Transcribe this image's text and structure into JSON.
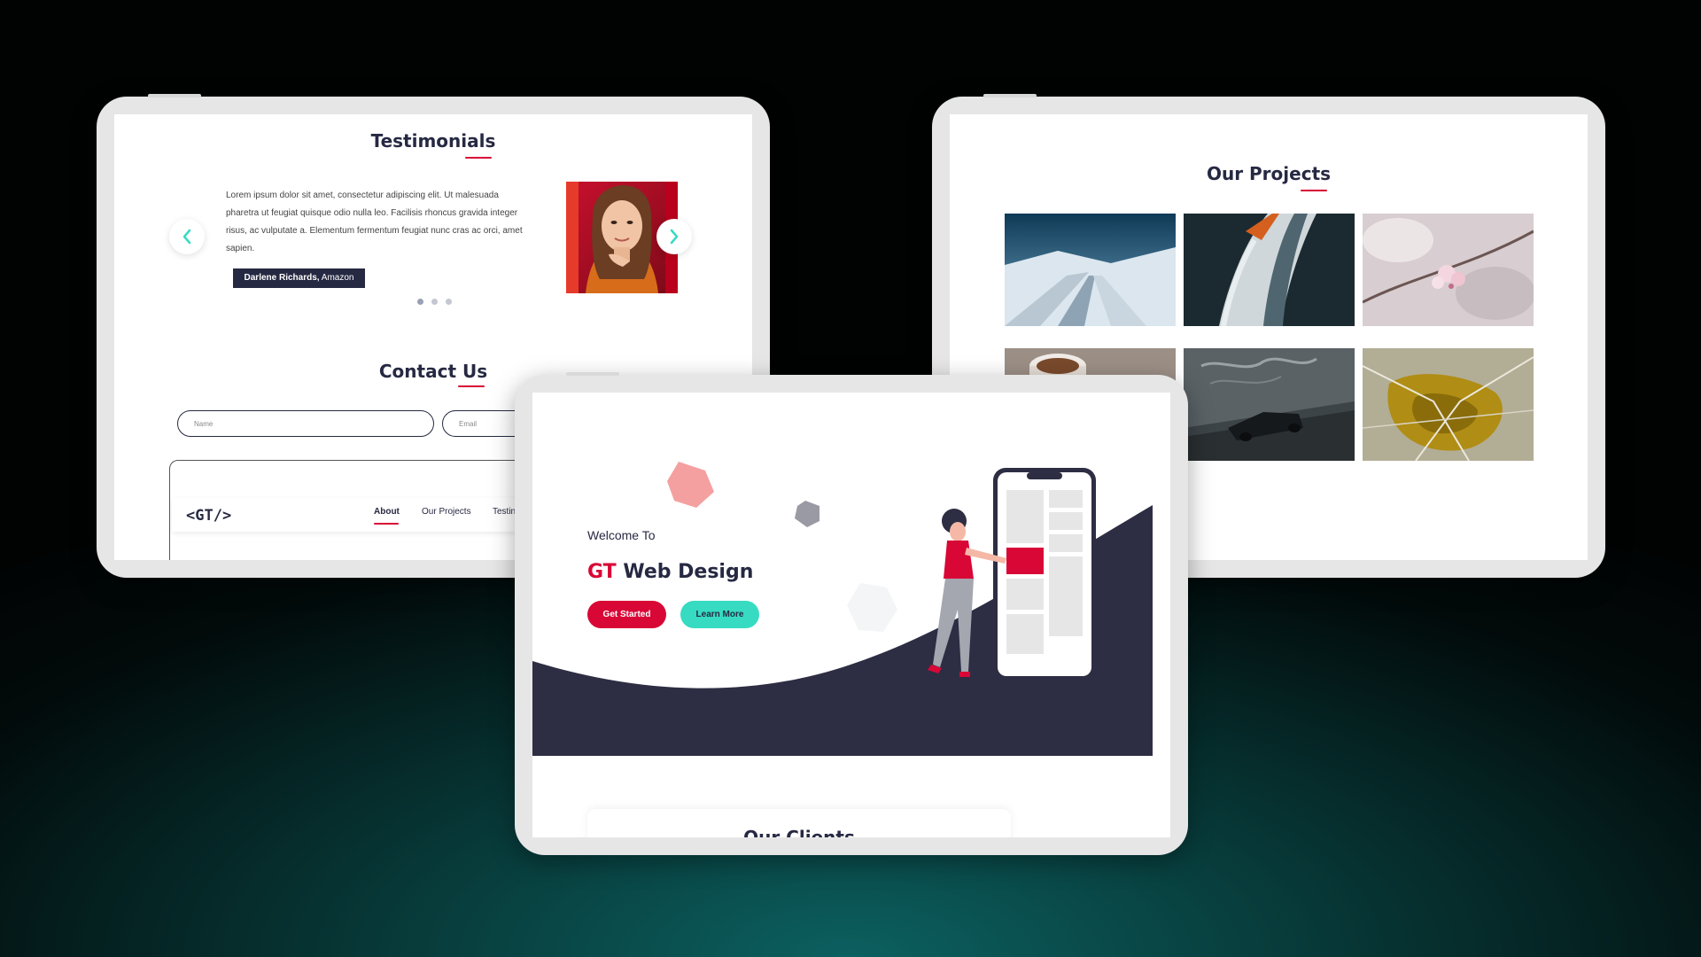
{
  "testimonials": {
    "title": "Testimonials",
    "quote": "Lorem ipsum dolor sit amet, consectetur adipiscing elit. Ut malesuada pharetra ut feugiat quisque odio nulla leo. Facilisis rhoncus gravida integer risus, ac vulputate a. Elementum fermentum feugiat nunc cras ac orci, amet sapien.",
    "author_name": "Darlene Richards,",
    "author_company": " Amazon",
    "dots": 3,
    "active_dot": 0,
    "prev_icon": "chevron-left-icon",
    "next_icon": "chevron-right-icon"
  },
  "contact": {
    "title": "Contact Us",
    "name_placeholder": "Name",
    "email_placeholder": "Email"
  },
  "navbar": {
    "logo": "<GT/>",
    "links": [
      "About",
      "Our Projects",
      "Testin"
    ],
    "active_link": "About"
  },
  "projects": {
    "title": "Our Projects",
    "images": [
      "snowy-road-photo",
      "bird-feathers-photo",
      "blossom-photo",
      "coffee-cup-photo",
      "car-graffiti-tunnel-photo",
      "aerial-yellow-water-photo"
    ]
  },
  "hero": {
    "welcome": "Welcome To",
    "title_accent": "GT",
    "title_rest": " Web Design",
    "primary_button": "Get Started",
    "secondary_button": "Learn More"
  },
  "clients": {
    "title": "Our Clients"
  },
  "colors": {
    "accent": "#d80736",
    "navy": "#262942",
    "teal": "#36dbc2",
    "background_glow": "#0c6060"
  }
}
